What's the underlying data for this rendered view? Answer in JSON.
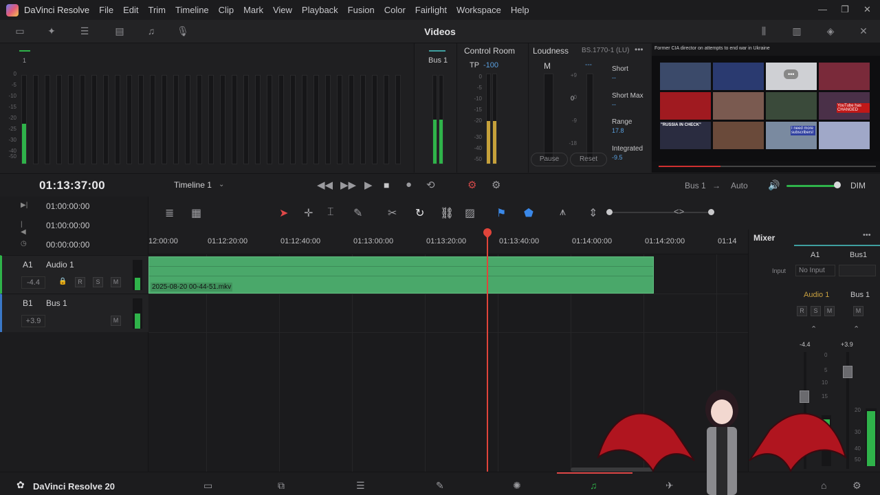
{
  "menubar": {
    "app_name": "DaVinci Resolve",
    "items": [
      "File",
      "Edit",
      "Trim",
      "Timeline",
      "Clip",
      "Mark",
      "View",
      "Playback",
      "Fusion",
      "Color",
      "Fairlight",
      "Workspace",
      "Help"
    ]
  },
  "toolbar": {
    "page_title": "Videos"
  },
  "meters": {
    "scale": [
      "0",
      "-5",
      "-10",
      "-15",
      "-20",
      "-25",
      "-30",
      "-40",
      "-50"
    ],
    "channel_label": "1"
  },
  "bus_meter": {
    "label": "Bus 1"
  },
  "control_room": {
    "title": "Control Room",
    "tp_label": "TP",
    "tp_value": "-100",
    "scale": [
      "0",
      "-5",
      "-10",
      "-15",
      "-20",
      "-30",
      "-40",
      "-50"
    ]
  },
  "loudness": {
    "title": "Loudness",
    "standard": "BS.1770-1 (LU)",
    "m_label": "M",
    "m_value": "---",
    "scale": [
      "+9",
      "0",
      "-9",
      "-18"
    ],
    "scale_center": "0",
    "short_label": "Short",
    "short_value": "--",
    "short_max_label": "Short Max",
    "short_max_value": "--",
    "range_label": "Range",
    "range_value": "17.8",
    "integrated_label": "Integrated",
    "integrated_value": "-9.5",
    "pause": "Pause",
    "reset": "Reset"
  },
  "viewer": {
    "headline": "Former CIA director on attempts to end war in Ukraine",
    "thumb_captions": [
      "\"RUSSIA IN CHECK\"",
      "I need more subscribers!",
      "YouTube has CHANGED"
    ]
  },
  "transport": {
    "timecode": "01:13:37:00",
    "timeline_name": "Timeline 1",
    "bus_out": "Bus 1",
    "bus_arrow": "→",
    "auto": "Auto",
    "dim": "DIM"
  },
  "track_header": {
    "tc_in": "01:00:00:00",
    "tc_out": "01:00:00:00",
    "tc_dur": "00:00:00:00",
    "tracks": [
      {
        "id": "A1",
        "name": "Audio 1",
        "volume": "-4.4",
        "buttons": [
          "R",
          "S",
          "M"
        ]
      },
      {
        "id": "B1",
        "name": "Bus 1",
        "volume": "+3.9",
        "buttons": [
          "M"
        ]
      }
    ]
  },
  "ruler": {
    "ticks": [
      "12:00:00",
      "01:12:20:00",
      "01:12:40:00",
      "01:13:00:00",
      "01:13:20:00",
      "01:13:40:00",
      "01:14:00:00",
      "01:14:20:00",
      "01:14"
    ]
  },
  "clip": {
    "name": "2025-08-20 00-44-51.mkv"
  },
  "mixer": {
    "title": "Mixer",
    "col_a": "A1",
    "col_b": "Bus1",
    "input_label": "Input",
    "input_value": "No Input",
    "strip_a": "Audio 1",
    "strip_b": "Bus 1",
    "buttons_a": [
      "R",
      "S",
      "M"
    ],
    "button_b": "M",
    "vol_a": "-4.4",
    "vol_b": "+3.9",
    "scale": [
      "0",
      "5",
      "10",
      "15",
      "20",
      "30",
      "40",
      "50"
    ]
  },
  "bottombar": {
    "brand": "DaVinci Resolve 20"
  }
}
